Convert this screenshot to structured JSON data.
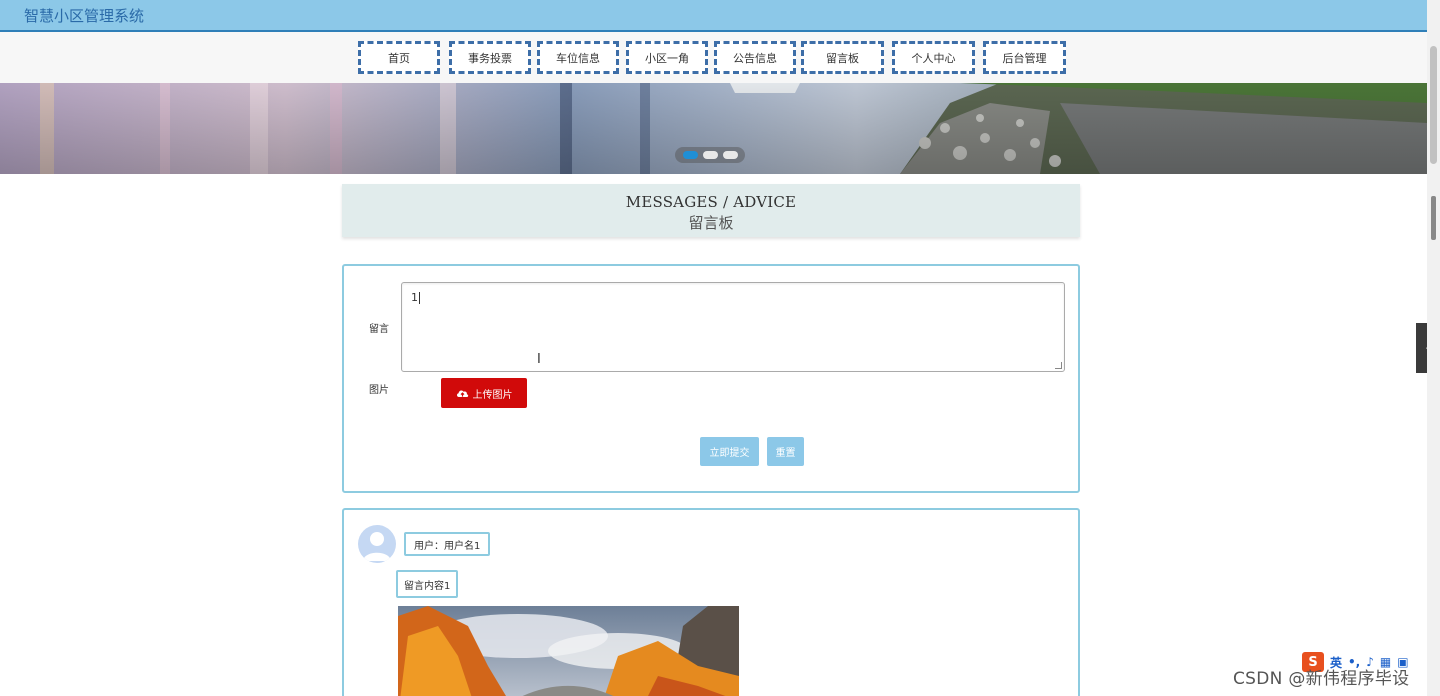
{
  "app": {
    "title": "智慧小区管理系统"
  },
  "nav": {
    "items": [
      {
        "label": "首页"
      },
      {
        "label": "事务投票"
      },
      {
        "label": "车位信息"
      },
      {
        "label": "小区一角"
      },
      {
        "label": "公告信息"
      },
      {
        "label": "留言板"
      },
      {
        "label": "个人中心"
      },
      {
        "label": "后台管理"
      }
    ]
  },
  "carousel": {
    "active_index": 0,
    "dot_count": 3
  },
  "section": {
    "title_en": "MESSAGES / ADVICE",
    "title_cn": "留言板"
  },
  "form": {
    "message_label": "留言",
    "message_value": "1",
    "image_label": "图片",
    "upload_label": "上传图片",
    "submit_label": "立即提交",
    "reset_label": "重置"
  },
  "comments": [
    {
      "user": "用户：用户名1",
      "content": "留言内容1"
    }
  ],
  "ime": {
    "mode": "英"
  },
  "watermark": "CSDN @新伟程序毕设",
  "colors": {
    "topbar": "#8cc8e8",
    "nav_border": "#3d6ea8",
    "panel_border": "#8dcbe0",
    "upload": "#d10a0a",
    "dot_active": "#1f8fd6"
  }
}
